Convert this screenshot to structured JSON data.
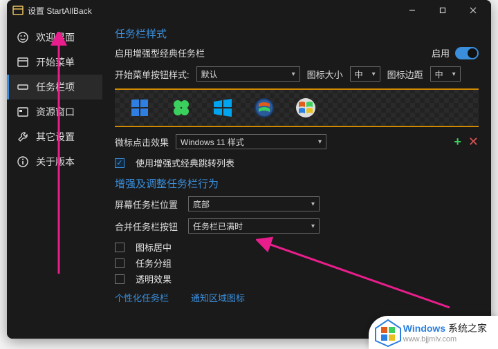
{
  "title": "设置 StartAllBack",
  "sidebar": {
    "items": [
      {
        "label": "欢迎界面",
        "icon": "smile-icon"
      },
      {
        "label": "开始菜单",
        "icon": "window-icon"
      },
      {
        "label": "任务栏项",
        "icon": "taskbar-icon"
      },
      {
        "label": "资源窗口",
        "icon": "explorer-icon"
      },
      {
        "label": "其它设置",
        "icon": "wrench-icon"
      },
      {
        "label": "关于版本",
        "icon": "info-icon"
      }
    ],
    "active_index": 2
  },
  "section1": {
    "title": "任务栏样式",
    "enable_label": "启用增强型经典任务栏",
    "enable_switch_label": "启用",
    "enable_on": true,
    "start_button_style_label": "开始菜单按钮样式:",
    "start_button_style_value": "默认",
    "icon_size_label": "图标大小",
    "icon_size_value": "中",
    "icon_margin_label": "图标边距",
    "icon_margin_value": "中",
    "click_effect_label": "微标点击效果",
    "click_effect_value": "Windows 11 样式",
    "jump_list_label": "使用增强式经典跳转列表",
    "jump_list_checked": true
  },
  "section2": {
    "title": "增强及调整任务栏行为",
    "position_label": "屏幕任务栏位置",
    "position_value": "底部",
    "combine_label": "合并任务栏按钮",
    "combine_value": "任务栏已满时",
    "center_icons_label": "图标居中",
    "center_icons_checked": false,
    "group_tasks_label": "任务分组",
    "group_tasks_checked": false,
    "transparency_label": "透明效果",
    "transparency_checked": false,
    "link_personalize": "个性化任务栏",
    "link_notification": "通知区域图标"
  },
  "brand": {
    "line1": "Windows 系统之家",
    "line2": "www.bjjmlv.com"
  }
}
